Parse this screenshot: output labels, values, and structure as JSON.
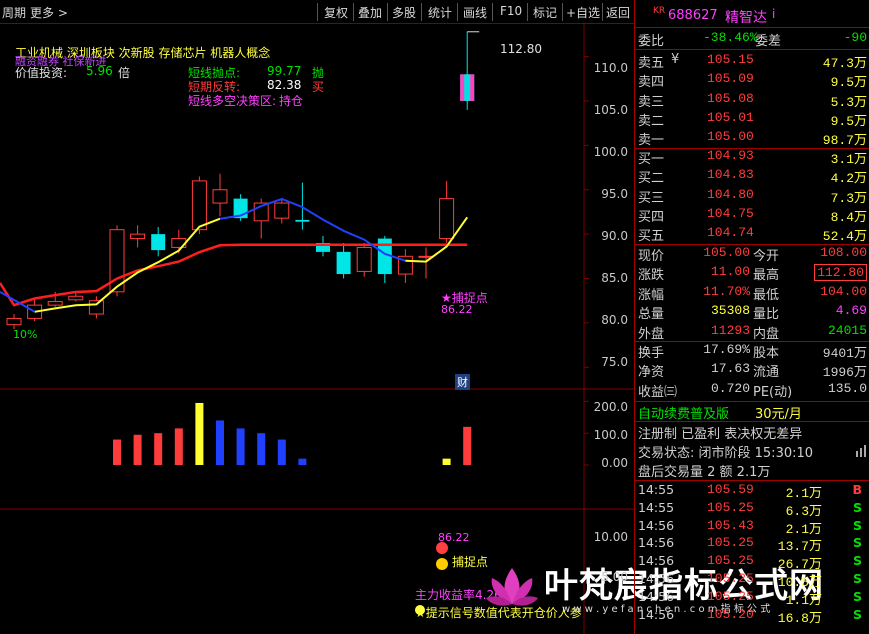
{
  "toolbar": {
    "left": [
      "周期",
      "更多"
    ],
    "right": [
      "复权",
      "叠加",
      "多股",
      "统计",
      "画线",
      "F10",
      "标记",
      "+自选",
      "返回"
    ]
  },
  "overlay": {
    "concepts": "工业机械  深圳板块  次新股 存储芯片 机器人概念",
    "purple_tags": "融资融券 社保新进",
    "value_label": "价值投资:",
    "value_num": "5.96",
    "value_unit": "倍",
    "sig1_label": "短线抛点:",
    "sig1_val": "99.77",
    "sig1_act": "抛",
    "sig2_label": "短期反转:",
    "sig2_val": "82.38",
    "sig2_act": "买",
    "sig3_label": "短线多空决策区:",
    "sig3_val": "持仓",
    "high_mark": "112.80",
    "pct_label": "10%",
    "buy_point": "★捕捉点",
    "buy_val": "86.22",
    "cai": "财",
    "ind_val": "86.22",
    "ind_buy": "捕捉点",
    "ind_main": "主力收益率4.26",
    "ind_note": "★提示信号数值代表开仓价人参",
    "watermark": "叶梵宸指标公式网",
    "watermark_url": "w w w . y e f a n c h e n . c o m   指 标 公 式"
  },
  "axes": {
    "main": [
      "110.0",
      "105.0",
      "100.0",
      "95.0",
      "90.0",
      "85.0",
      "80.0",
      "75.0"
    ],
    "vol": [
      "200.0",
      "100.0",
      "0.00"
    ],
    "ind": [
      "10.00",
      "5.00"
    ]
  },
  "stock": {
    "tag": "KR",
    "code": "688627",
    "name": "精智达",
    "info": "i"
  },
  "bidask": {
    "weibi_label": "委比",
    "weibi": "-38.46%",
    "weicha_label": "委差",
    "weicha": "-90",
    "asks": [
      {
        "label": "卖五",
        "mark": "¥",
        "price": "105.15",
        "vol": "47.3万"
      },
      {
        "label": "卖四",
        "mark": "",
        "price": "105.09",
        "vol": "9.5万"
      },
      {
        "label": "卖三",
        "mark": "",
        "price": "105.08",
        "vol": "5.3万"
      },
      {
        "label": "卖二",
        "mark": "",
        "price": "105.01",
        "vol": "9.5万"
      },
      {
        "label": "卖一",
        "mark": "",
        "price": "105.00",
        "vol": "98.7万"
      }
    ],
    "bids": [
      {
        "label": "买一",
        "price": "104.93",
        "vol": "3.1万"
      },
      {
        "label": "买二",
        "price": "104.83",
        "vol": "4.2万"
      },
      {
        "label": "买三",
        "price": "104.80",
        "vol": "7.3万"
      },
      {
        "label": "买四",
        "price": "104.75",
        "vol": "8.4万"
      },
      {
        "label": "买五",
        "price": "104.74",
        "vol": "52.4万"
      }
    ]
  },
  "quote": [
    {
      "l1": "现价",
      "v1": "105.00",
      "c1": "red",
      "l2": "今开",
      "v2": "108.00",
      "c2": "red"
    },
    {
      "l1": "涨跌",
      "v1": "11.00",
      "c1": "red",
      "l2": "最高",
      "v2": "112.80",
      "c2": "red"
    },
    {
      "l1": "涨幅",
      "v1": "11.70%",
      "c1": "red",
      "l2": "最低",
      "v2": "104.00",
      "c2": "red"
    },
    {
      "l1": "总量",
      "v1": "35308",
      "c1": "yellow",
      "l2": "量比",
      "v2": "4.69",
      "c2": "mag"
    },
    {
      "l1": "外盘",
      "v1": "11293",
      "c1": "red",
      "l2": "内盘",
      "v2": "24015",
      "c2": "green"
    }
  ],
  "fund": [
    {
      "l1": "换手",
      "v1": "17.69%",
      "l2": "股本",
      "v2": "9401万"
    },
    {
      "l1": "净资",
      "v1": "17.63",
      "l2": "流通",
      "v2": "1996万"
    },
    {
      "l1": "收益㈢",
      "v1": "0.720",
      "l2": "PE(动)",
      "v2": "135.0"
    }
  ],
  "misc": {
    "fee_label": "自动续费普及版",
    "fee_price": "30元/月",
    "reg": "注册制 已盈利 表决权无差异",
    "status": "交易状态: 闭市阶段 15:30:10",
    "after": "盘后交易量 2 额 2.1万"
  },
  "ticks": [
    {
      "time": "14:55",
      "price": "105.59",
      "vol": "2.1万",
      "side": "B"
    },
    {
      "time": "14:55",
      "price": "105.25",
      "vol": "6.3万",
      "side": "S"
    },
    {
      "time": "14:56",
      "price": "105.43",
      "vol": "2.1万",
      "side": "S"
    },
    {
      "time": "14:56",
      "price": "105.25",
      "vol": "13.7万",
      "side": "S"
    },
    {
      "time": "14:56",
      "price": "105.25",
      "vol": "26.7万",
      "side": "S"
    },
    {
      "time": "14:56",
      "price": "105.25",
      "vol": "10.5万",
      "side": "S"
    },
    {
      "time": "14:56",
      "price": "105.25",
      "vol": "1.1万",
      "side": "S"
    },
    {
      "time": "14:56",
      "price": "105.20",
      "vol": "16.8万",
      "side": "S"
    }
  ],
  "chart_data": {
    "type": "candlestick",
    "candles": [
      {
        "o": 79.8,
        "c": 80.5,
        "h": 81.0,
        "l": 79.3
      },
      {
        "o": 80.5,
        "c": 82.0,
        "h": 82.8,
        "l": 80.2
      },
      {
        "o": 82.0,
        "c": 82.4,
        "h": 83.5,
        "l": 81.8
      },
      {
        "o": 82.6,
        "c": 83.0,
        "h": 83.6,
        "l": 82.4
      },
      {
        "o": 81.0,
        "c": 82.5,
        "h": 83.0,
        "l": 80.5
      },
      {
        "o": 83.5,
        "c": 90.5,
        "h": 91.0,
        "l": 83.0
      },
      {
        "o": 89.5,
        "c": 90.0,
        "h": 91.0,
        "l": 88.5
      },
      {
        "o": 90.0,
        "c": 88.2,
        "h": 90.8,
        "l": 87.5
      },
      {
        "o": 88.5,
        "c": 89.5,
        "h": 90.5,
        "l": 87.8
      },
      {
        "o": 90.5,
        "c": 96.0,
        "h": 96.5,
        "l": 90.0
      },
      {
        "o": 93.5,
        "c": 95.0,
        "h": 96.8,
        "l": 92.0
      },
      {
        "o": 94.0,
        "c": 91.8,
        "h": 94.5,
        "l": 91.5
      },
      {
        "o": 91.5,
        "c": 93.5,
        "h": 94.0,
        "l": 89.5
      },
      {
        "o": 91.8,
        "c": 93.5,
        "h": 94.0,
        "l": 91.2
      },
      {
        "o": 91.6,
        "c": 91.4,
        "h": 95.8,
        "l": 90.5
      },
      {
        "o": 89.0,
        "c": 88.0,
        "h": 89.8,
        "l": 87.5
      },
      {
        "o": 88.0,
        "c": 85.5,
        "h": 89.0,
        "l": 85.0
      },
      {
        "o": 85.8,
        "c": 88.5,
        "h": 89.0,
        "l": 85.2
      },
      {
        "o": 89.5,
        "c": 85.5,
        "h": 89.8,
        "l": 84.5
      },
      {
        "o": 85.5,
        "c": 87.5,
        "h": 88.3,
        "l": 84.5
      },
      {
        "o": 87.5,
        "c": 87.5,
        "h": 88.5,
        "l": 85.0
      },
      {
        "o": 89.5,
        "c": 94.0,
        "h": 96.0,
        "l": 89.0
      },
      {
        "o": 108.0,
        "c": 105.0,
        "h": 112.8,
        "l": 104.0
      }
    ],
    "volumes": [
      0,
      0,
      0,
      0,
      0,
      80,
      95,
      100,
      115,
      195,
      140,
      115,
      100,
      80,
      20,
      0,
      0,
      0,
      0,
      0,
      0,
      20,
      120
    ],
    "ylim": [
      73,
      113
    ],
    "vol_ylim": [
      0,
      220
    ],
    "ind_ylim": [
      0,
      12
    ]
  },
  "colors": {
    "up": "#ff3c3c",
    "down": "#00e6e6",
    "ma_red": "#ff1e1e",
    "ma_yellow": "#ffff30",
    "ma_blue": "#2040ff",
    "grid": "#800000"
  }
}
